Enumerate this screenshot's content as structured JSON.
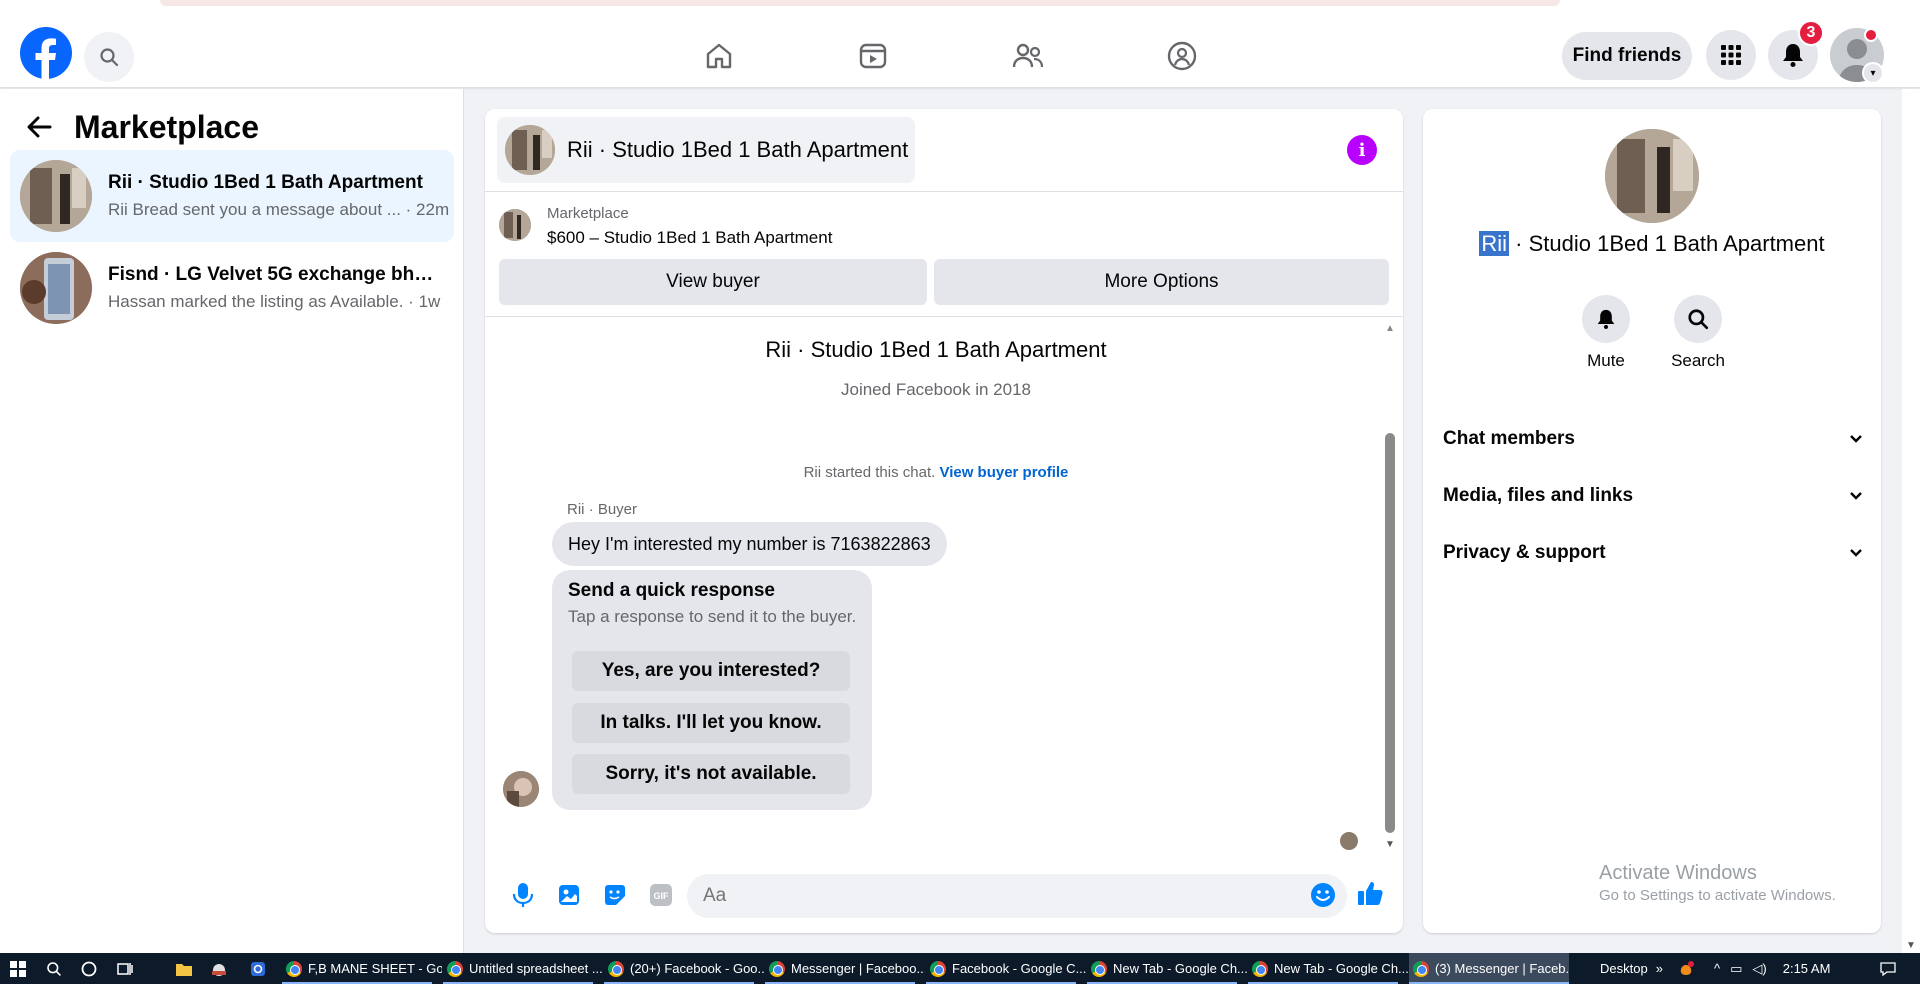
{
  "header": {
    "find_friends": "Find friends",
    "notification_count": "3",
    "icons": [
      "facebook-logo",
      "search-icon",
      "home-icon",
      "video-icon",
      "friends-icon",
      "groups-icon",
      "menu-grid-icon",
      "bell-icon"
    ]
  },
  "sidebar": {
    "title": "Marketplace",
    "conversations": [
      {
        "title": "Rii · Studio 1Bed 1 Bath Apartment",
        "preview": "Rii Bread sent you a message about ... · 22m"
      },
      {
        "title": "Fisnd · LG Velvet 5G exchange bhi ...",
        "preview": "Hassan marked the listing as Available. · 1w"
      }
    ]
  },
  "chat": {
    "title": "Rii · Studio 1Bed 1 Bath Apartment",
    "listing_label": "Marketplace",
    "listing_price": "$600 – Studio 1Bed 1 Bath Apartment",
    "view_buyer": "View buyer",
    "more_options": "More Options",
    "profile_name": "Rii · Studio 1Bed 1 Bath Apartment",
    "joined": "Joined Facebook in 2018",
    "started_text": "Rii started this chat.",
    "view_buyer_profile": "View buyer profile",
    "sender_label": "Rii · Buyer",
    "message": "Hey I'm interested my number is 7163822863",
    "quick_title": "Send a quick response",
    "quick_sub": "Tap a response to send it to the buyer.",
    "quick_replies": [
      "Yes, are you interested?",
      "In talks. I'll let you know.",
      "Sorry, it's not available."
    ],
    "composer_placeholder": "Aa"
  },
  "right_panel": {
    "title_highlight": "Rii",
    "title_rest": " · Studio 1Bed 1 Bath Apartment",
    "mute": "Mute",
    "search": "Search",
    "sections": [
      "Chat members",
      "Media, files and links",
      "Privacy & support"
    ],
    "activate_title": "Activate Windows",
    "activate_sub": "Go to Settings to activate Windows."
  },
  "taskbar": {
    "apps": [
      "F,B MANE SHEET - Go...",
      "Untitled spreadsheet ...",
      "(20+) Facebook - Goo...",
      "Messenger | Faceboo...",
      "Facebook - Google C...",
      "New Tab - Google Ch...",
      "New Tab - Google Ch...",
      "(3) Messenger | Faceb..."
    ],
    "desktop": "Desktop",
    "time": "2:15 AM"
  },
  "colors": {
    "brand": "#0866ff",
    "info": "#b800ff",
    "link": "#0064d1",
    "badge": "#e41e3f"
  }
}
